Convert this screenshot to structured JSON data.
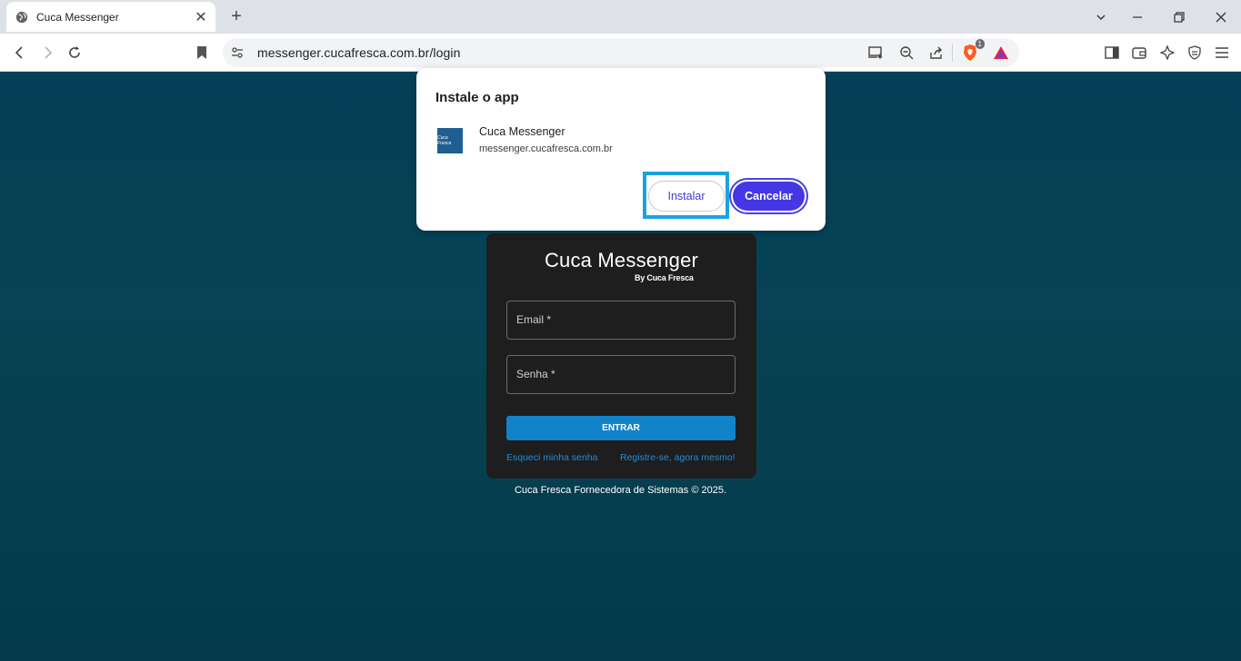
{
  "browser": {
    "tab_title": "Cuca Messenger",
    "new_tab_label": "+",
    "url": "messenger.cucafresca.com.br/login",
    "shield_badge_count": "1"
  },
  "install_dialog": {
    "title": "Instale o app",
    "app_name": "Cuca Messenger",
    "app_domain": "messenger.cucafresca.com.br",
    "icon_text": "Cuca Fresca",
    "install_label": "Instalar",
    "cancel_label": "Cancelar"
  },
  "login": {
    "brand_title": "Cuca Messenger",
    "brand_byline": "By Cuca Fresca",
    "email_label": "Email *",
    "password_label": "Senha *",
    "submit_label": "ENTRAR",
    "forgot_link": "Esqueci minha senha",
    "register_link": "Registre-se, agora mesmo!"
  },
  "footer": {
    "copyright": "Cuca Fresca Fornecedora de Sistemas © 2025."
  },
  "colors": {
    "page_background": "#053f58",
    "card_background": "#1e1e1e",
    "primary_button": "#1383c9",
    "link": "#1c8ee0",
    "dialog_accent": "#4536e6",
    "highlight": "#1aa3e0"
  }
}
